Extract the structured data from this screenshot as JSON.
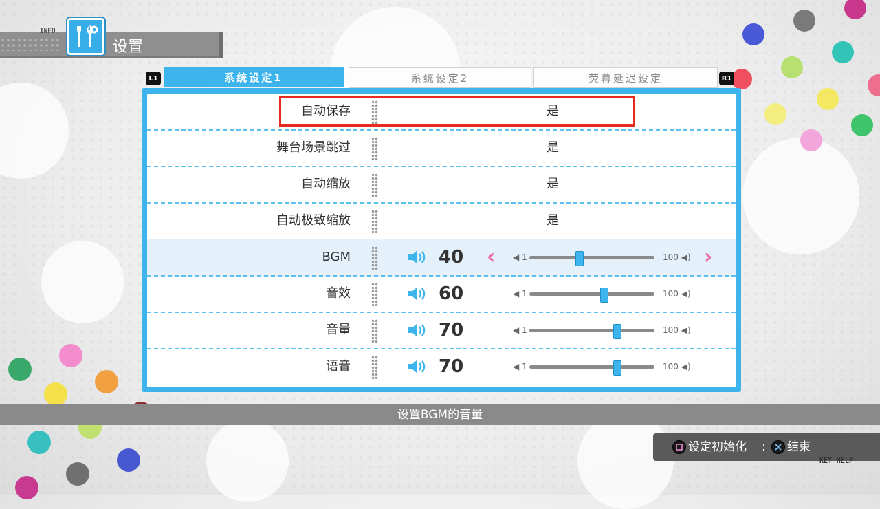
{
  "header": {
    "info_label": "INFO",
    "title": "设置",
    "icon": "tools-icon"
  },
  "tabs": [
    {
      "label": "系统设定1",
      "active": true
    },
    {
      "label": "系统设定2",
      "active": false
    },
    {
      "label": "荧幕延迟设定",
      "active": false
    }
  ],
  "shoulder_buttons": {
    "left": "L1",
    "right": "R1"
  },
  "rows": [
    {
      "label": "自动保存",
      "value": "是"
    },
    {
      "label": "舞台场景跳过",
      "value": "是"
    },
    {
      "label": "自动缩放",
      "value": "是"
    },
    {
      "label": "自动极致缩放",
      "value": "是"
    },
    {
      "label": "BGM",
      "volume": "40",
      "min": "1",
      "max": "100",
      "level": 40
    },
    {
      "label": "音效",
      "volume": "60",
      "min": "1",
      "max": "100",
      "level": 60
    },
    {
      "label": "音量",
      "volume": "70",
      "min": "1",
      "max": "100",
      "level": 70
    },
    {
      "label": "语音",
      "volume": "70",
      "min": "1",
      "max": "100",
      "level": 70
    }
  ],
  "description": "设置BGM的音量",
  "key_help": {
    "reset_label": "设定初始化",
    "separator": ":",
    "end_label": "结束",
    "reset_icon": "square-button-icon",
    "end_icon": "cross-button-icon",
    "footer": "KEY HELP"
  },
  "colors": {
    "accent": "#3db4ec",
    "arrow": "#ee6ea6",
    "highlight": "#e62a1e"
  }
}
